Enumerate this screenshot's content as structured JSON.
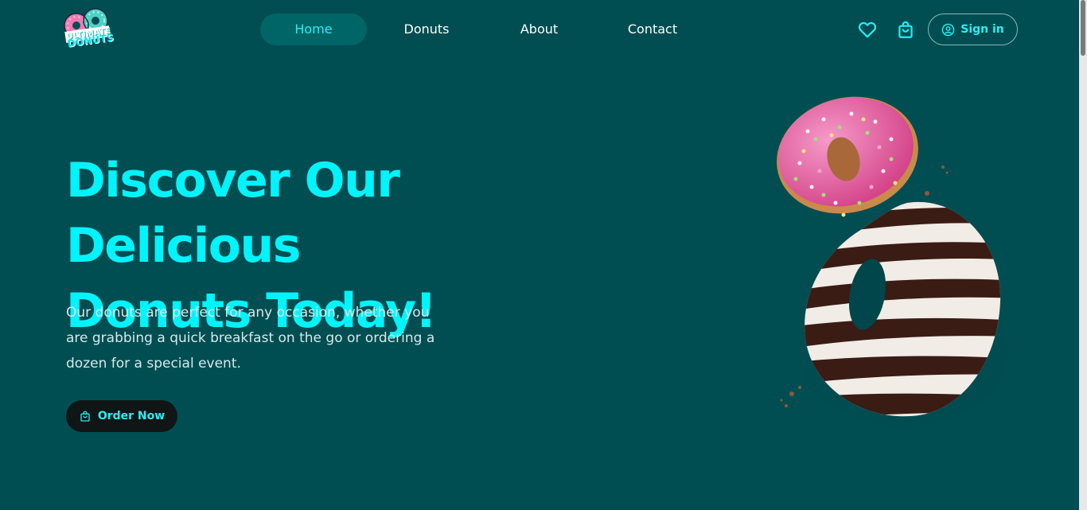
{
  "header": {
    "logo": {
      "line1": "ULTIMATE",
      "line2": "DONUTS",
      "icon": "donuts-logo-icon"
    },
    "nav": [
      {
        "label": "Home",
        "active": true
      },
      {
        "label": "Donuts",
        "active": false
      },
      {
        "label": "About",
        "active": false
      },
      {
        "label": "Contact",
        "active": false
      }
    ],
    "actions": {
      "wishlist_icon": "heart-icon",
      "cart_icon": "shopping-bag-icon",
      "sign_in_label": "Sign in",
      "sign_in_icon": "user-circle-icon"
    }
  },
  "hero": {
    "title_line1": "Discover Our Delicious",
    "title_line2": "Donuts Today!",
    "description": "Our donuts are perfect for any occasion, whether you are grabbing a quick breakfast on the go or ordering a dozen for a special event.",
    "order_button_label": "Order Now",
    "order_button_icon": "shopping-bag-icon",
    "image_icon": "donuts-image"
  },
  "colors": {
    "background": "#004e52",
    "accent": "#00f4fb",
    "nav_active_bg": "#006566",
    "button_dark": "#0f1615",
    "text_light": "#d7e9e9"
  }
}
